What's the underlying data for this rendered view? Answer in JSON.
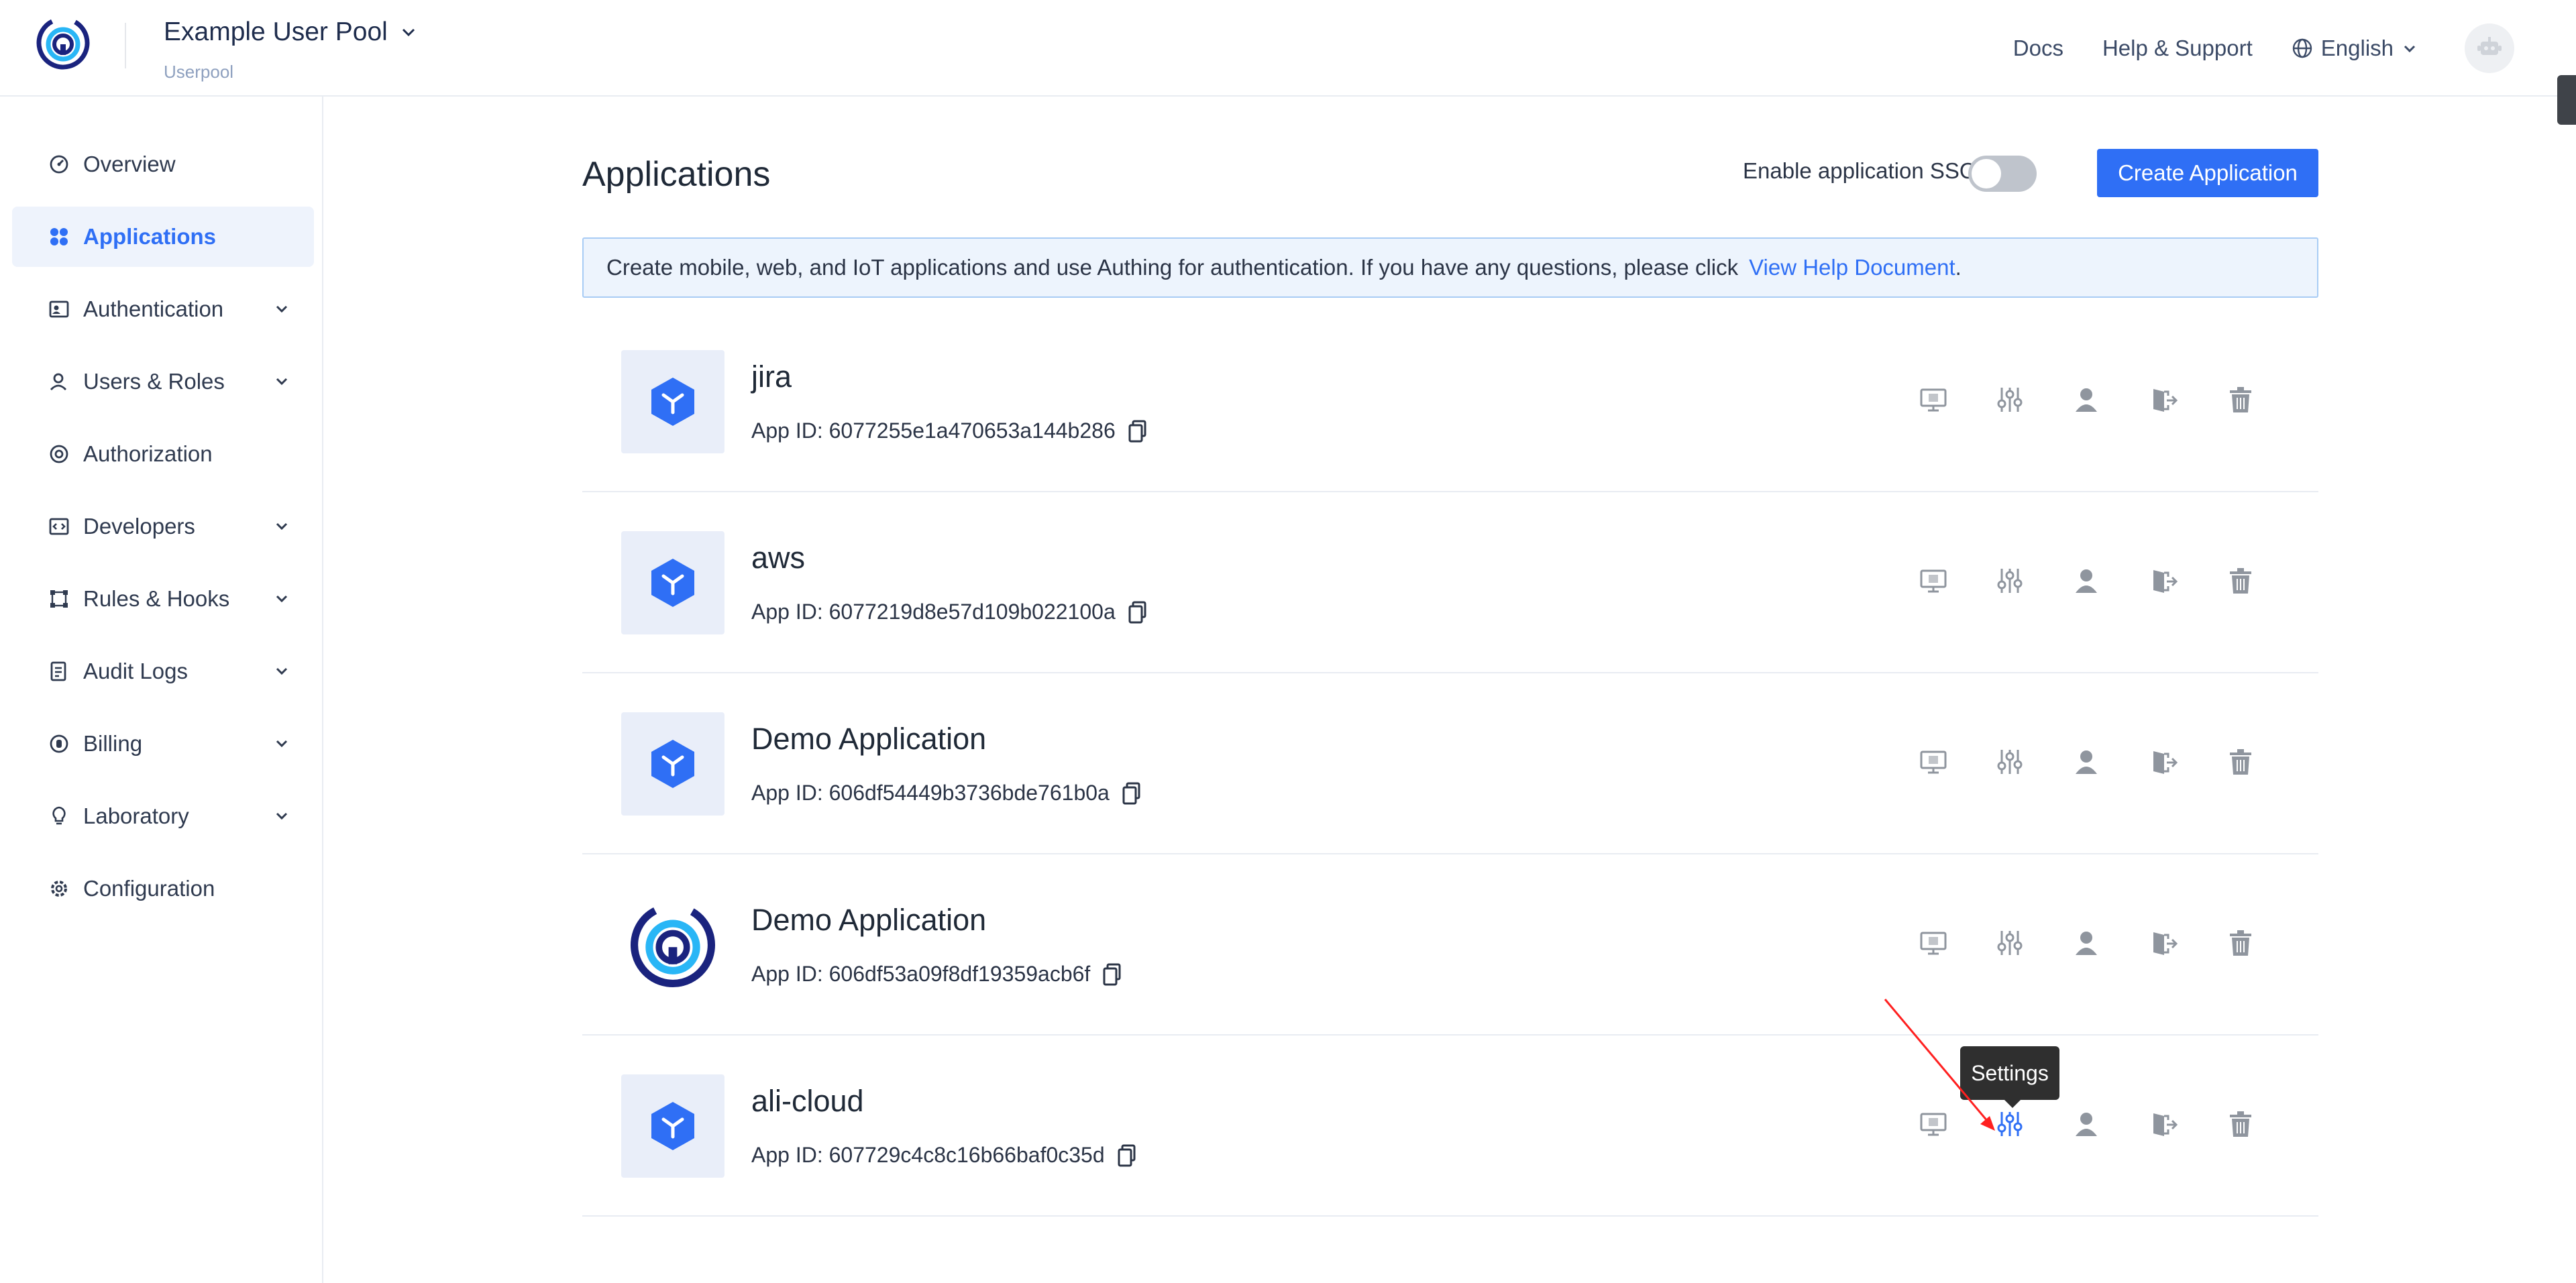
{
  "header": {
    "pool_name": "Example User Pool",
    "pool_sub": "Userpool",
    "docs": "Docs",
    "help": "Help & Support",
    "language": "English"
  },
  "sidebar": {
    "items": [
      {
        "label": "Overview",
        "icon": "gauge-icon",
        "expandable": false,
        "active": false
      },
      {
        "label": "Applications",
        "icon": "grid-icon",
        "expandable": false,
        "active": true
      },
      {
        "label": "Authentication",
        "icon": "id-card-icon",
        "expandable": true,
        "active": false
      },
      {
        "label": "Users & Roles",
        "icon": "user-icon",
        "expandable": true,
        "active": false
      },
      {
        "label": "Authorization",
        "icon": "at-icon",
        "expandable": false,
        "active": false
      },
      {
        "label": "Developers",
        "icon": "code-icon",
        "expandable": true,
        "active": false
      },
      {
        "label": "Rules & Hooks",
        "icon": "nodes-icon",
        "expandable": true,
        "active": false
      },
      {
        "label": "Audit Logs",
        "icon": "document-icon",
        "expandable": true,
        "active": false
      },
      {
        "label": "Billing",
        "icon": "coin-icon",
        "expandable": true,
        "active": false
      },
      {
        "label": "Laboratory",
        "icon": "bulb-icon",
        "expandable": true,
        "active": false
      },
      {
        "label": "Configuration",
        "icon": "gear-icon",
        "expandable": false,
        "active": false
      }
    ]
  },
  "main": {
    "title": "Applications",
    "sso_label": "Enable application SSO",
    "sso_enabled": false,
    "create_button": "Create Application",
    "notice_text": "Create mobile, web, and IoT applications and use Authing for authentication. If you have any questions, please click",
    "notice_link": "View Help Document",
    "notice_end": "."
  },
  "apps": [
    {
      "name": "jira",
      "app_id": "App ID: 6077255e1a470653a144b286",
      "logo": "cube-icon"
    },
    {
      "name": "aws",
      "app_id": "App ID: 6077219d8e57d109b022100a",
      "logo": "cube-icon"
    },
    {
      "name": "Demo Application",
      "app_id": "App ID: 606df54449b3736bde761b0a",
      "logo": "cube-icon"
    },
    {
      "name": "Demo Application",
      "app_id": "App ID: 606df53a09f8df19359acb6f",
      "logo": "authing-logo"
    },
    {
      "name": "ali-cloud",
      "app_id": "App ID: 607729c4c8c16b66baf0c35d",
      "logo": "cube-icon"
    }
  ],
  "row_actions": [
    "monitor-icon",
    "settings-sliders-icon",
    "user-icon",
    "logout-icon",
    "trash-icon"
  ],
  "tooltip": "Settings",
  "colors": {
    "accent": "#2f6ff5",
    "icon_gray": "#8f959e",
    "annotation_red": "#ff2020"
  }
}
